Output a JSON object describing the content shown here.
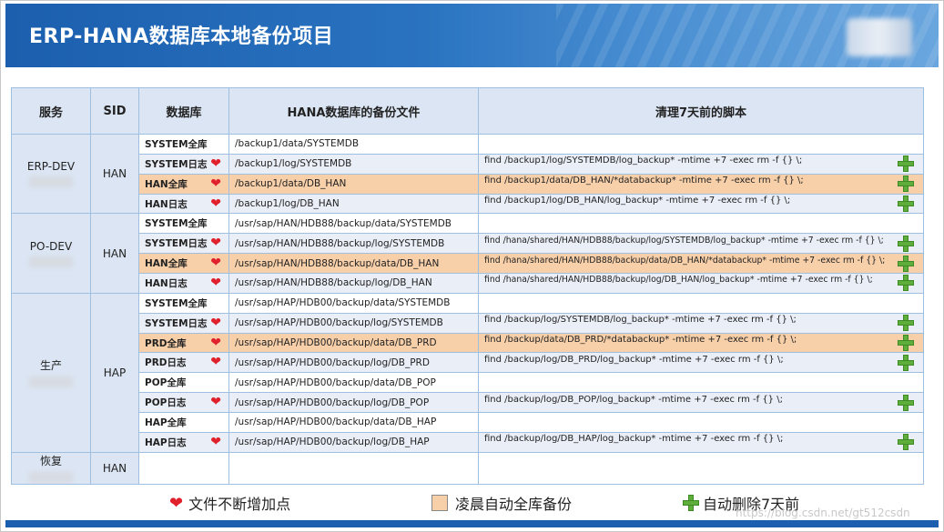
{
  "slide": {
    "title": "ERP-HANA数据库本地备份项目",
    "watermark": "https://blog.csdn.net/gt512csdn"
  },
  "table": {
    "headers": [
      "服务",
      "SID",
      "数据库",
      "HANA数据库的备份文件",
      "清理7天前的脚本"
    ],
    "groups": [
      {
        "service": "ERP-DEV",
        "sid": "HAN",
        "rows": [
          {
            "db": "SYSTEM全库",
            "heart": false,
            "highlight": false,
            "backup": "/backup1/data/SYSTEMDB",
            "script": "",
            "plus": false
          },
          {
            "db": "SYSTEM日志",
            "heart": true,
            "highlight": false,
            "backup": "/backup1/log/SYSTEMDB",
            "script": "find /backup1/log/SYSTEMDB/log_backup*  -mtime +7 -exec rm -f {} \\;",
            "plus": true
          },
          {
            "db": "HAN全库",
            "heart": true,
            "highlight": true,
            "backup": "/backup1/data/DB_HAN",
            "script": "find /backup1/data/DB_HAN/*databackup*  -mtime +7 -exec rm -f {} \\;",
            "plus": true
          },
          {
            "db": "HAN日志",
            "heart": true,
            "highlight": false,
            "backup": "/backup1/log/DB_HAN",
            "script": "find /backup1/log/DB_HAN/log_backup*  -mtime +7 -exec rm -f {} \\;",
            "plus": true
          }
        ]
      },
      {
        "service": "PO-DEV",
        "sid": "HAN",
        "rows": [
          {
            "db": "SYSTEM全库",
            "heart": false,
            "highlight": false,
            "backup": "/usr/sap/HAN/HDB88/backup/data/SYSTEMDB",
            "script": "",
            "plus": false
          },
          {
            "db": "SYSTEM日志",
            "heart": true,
            "highlight": false,
            "backup": "/usr/sap/HAN/HDB88/backup/log/SYSTEMDB",
            "script": "find /hana/shared/HAN/HDB88/backup/log/SYSTEMDB/log_backup*  -mtime +7 -exec rm -f {} \\;",
            "plus": true
          },
          {
            "db": "HAN全库",
            "heart": true,
            "highlight": true,
            "backup": "/usr/sap/HAN/HDB88/backup/data/DB_HAN",
            "script": "find /hana/shared/HAN/HDB88/backup/data/DB_HAN/*databackup*  -mtime +7 -exec rm -f {} \\;",
            "plus": true
          },
          {
            "db": "HAN日志",
            "heart": true,
            "highlight": false,
            "backup": "/usr/sap/HAN/HDB88/backup/log/DB_HAN",
            "script": "find /hana/shared/HAN/HDB88/backup/log/DB_HAN/log_backup*  -mtime +7 -exec rm -f {} \\;",
            "plus": true
          }
        ]
      },
      {
        "service": "生产",
        "sid": "HAP",
        "rows": [
          {
            "db": "SYSTEM全库",
            "heart": false,
            "highlight": false,
            "backup": "/usr/sap/HAP/HDB00/backup/data/SYSTEMDB",
            "script": "",
            "plus": false
          },
          {
            "db": "SYSTEM日志",
            "heart": true,
            "highlight": false,
            "backup": "/usr/sap/HAP/HDB00/backup/log/SYSTEMDB",
            "script": "find /backup/log/SYSTEMDB/log_backup*  -mtime +7 -exec rm -f {} \\;",
            "plus": true
          },
          {
            "db": "PRD全库",
            "heart": true,
            "highlight": true,
            "backup": "/usr/sap/HAP/HDB00/backup/data/DB_PRD",
            "script": "find /backup/data/DB_PRD/*databackup*  -mtime +7 -exec rm -f {} \\;",
            "plus": true
          },
          {
            "db": "PRD日志",
            "heart": true,
            "highlight": false,
            "backup": "/usr/sap/HAP/HDB00/backup/log/DB_PRD",
            "script": "find /backup/log/DB_PRD/log_backup*  -mtime +7 -exec rm -f {} \\;",
            "plus": true
          },
          {
            "db": "POP全库",
            "heart": false,
            "highlight": false,
            "backup": "/usr/sap/HAP/HDB00/backup/data/DB_POP",
            "script": "",
            "plus": false
          },
          {
            "db": "POP日志",
            "heart": true,
            "highlight": false,
            "backup": "/usr/sap/HAP/HDB00/backup/log/DB_POP",
            "script": "find /backup/log/DB_POP/log_backup*  -mtime +7 -exec rm -f {} \\;",
            "plus": true
          },
          {
            "db": "HAP全库",
            "heart": false,
            "highlight": false,
            "backup": "/usr/sap/HAP/HDB00/backup/data/DB_HAP",
            "script": "",
            "plus": false
          },
          {
            "db": "HAP日志",
            "heart": true,
            "highlight": false,
            "backup": "/usr/sap/HAP/HDB00/backup/log/DB_HAP",
            "script": "find /backup/log/DB_HAP/log_backup*  -mtime +7 -exec rm -f {} \\;",
            "plus": true
          }
        ]
      },
      {
        "service": "恢复",
        "sid": "HAN",
        "rows": [
          {
            "db": "",
            "heart": false,
            "highlight": false,
            "backup": "",
            "script": "",
            "plus": false
          }
        ]
      }
    ]
  },
  "legend": {
    "heart_label": "文件不断增加点",
    "box_label": "凌晨自动全库备份",
    "plus_label": "自动删除7天前"
  },
  "colors": {
    "banner": "#1b5fae",
    "header_bg": "#dbe5f3",
    "highlight": "#f7cfa9",
    "heart": "#e0202a",
    "plus": "#5fae3c"
  },
  "icons": {
    "heart": "heart-icon",
    "plus": "plus-icon"
  }
}
